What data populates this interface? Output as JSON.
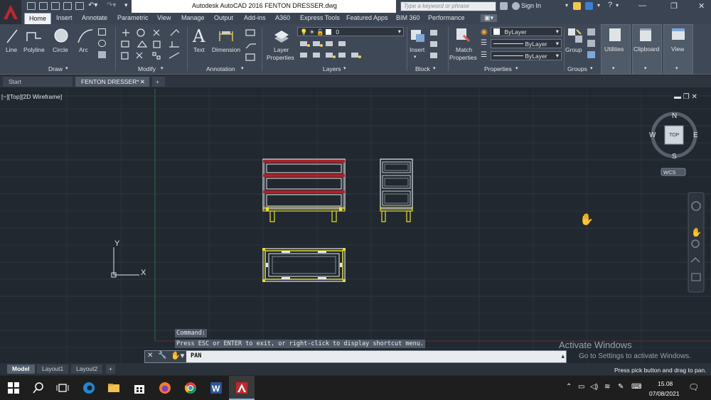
{
  "titlebar": {
    "title": "Autodesk AutoCAD 2016    FENTON DRESSER.dwg",
    "search_placeholder": "Type a keyword or phrase",
    "signin": "Sign In"
  },
  "ribbon_tabs": [
    "Home",
    "Insert",
    "Annotate",
    "Parametric",
    "View",
    "Manage",
    "Output",
    "Add-ins",
    "A360",
    "Express Tools",
    "Featured Apps",
    "BIM 360",
    "Performance"
  ],
  "ribbon": {
    "draw": {
      "title": "Draw",
      "tools": [
        "Line",
        "Polyline",
        "Circle",
        "Arc"
      ]
    },
    "modify": {
      "title": "Modify"
    },
    "annotation": {
      "title": "Annotation",
      "tools": [
        "Text",
        "Dimension"
      ]
    },
    "layers": {
      "title": "Layers",
      "layer_properties_l1": "Layer",
      "layer_properties_l2": "Properties",
      "current_layer": "0"
    },
    "block": {
      "title": "Block",
      "insert": "Insert"
    },
    "properties": {
      "title": "Properties",
      "match_l1": "Match",
      "match_l2": "Properties",
      "color": "ByLayer",
      "linetype": "ByLayer",
      "lineweight": "ByLayer"
    },
    "groups": {
      "title": "Groups",
      "group": "Group"
    },
    "utilities": "Utilities",
    "clipboard": "Clipboard",
    "view": "View"
  },
  "file_tabs": [
    "Start",
    "FENTON DRESSER*"
  ],
  "viewport": {
    "label": "[−][Top][2D Wireframe]",
    "compass": {
      "n": "N",
      "s": "S",
      "e": "E",
      "w": "W",
      "top": "TOP"
    },
    "wcs": "WCS",
    "ucs_x": "X",
    "ucs_y": "Y"
  },
  "command": {
    "history": [
      "Command:",
      "Press ESC or ENTER to exit, or right-click to display shortcut menu."
    ],
    "input": "PAN"
  },
  "watermark": {
    "line1": "Activate Windows",
    "line2": "Go to Settings to activate Windows."
  },
  "layout_tabs": [
    "Model",
    "Layout1",
    "Layout2"
  ],
  "status_message": "Press pick button and drag to pan.",
  "taskbar": {
    "time": "15.08",
    "date": "07/08/2021"
  },
  "colors": {
    "accent_red": "#c1272d",
    "frame_yellow": "#e8e12a",
    "drawer_red": "#a8232a"
  }
}
